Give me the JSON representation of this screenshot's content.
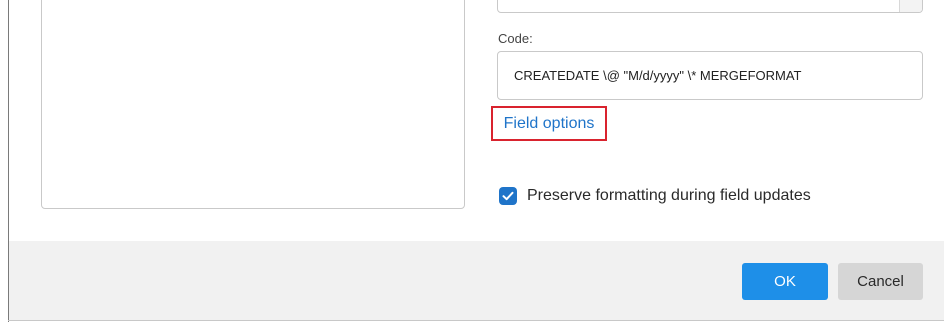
{
  "code": {
    "label": "Code:",
    "value": "CREATEDATE \\@ \"M/d/yyyy\" \\* MERGEFORMAT"
  },
  "field_options": {
    "label": "Field options"
  },
  "preserve_formatting": {
    "label": "Preserve formatting during field updates",
    "checked": true
  },
  "footer": {
    "ok_label": "OK",
    "cancel_label": "Cancel"
  },
  "colors": {
    "accent": "#1e8fe8",
    "link": "#1f74c9",
    "highlight_box": "#d9232e",
    "footer_bg": "#f1f1f1"
  }
}
